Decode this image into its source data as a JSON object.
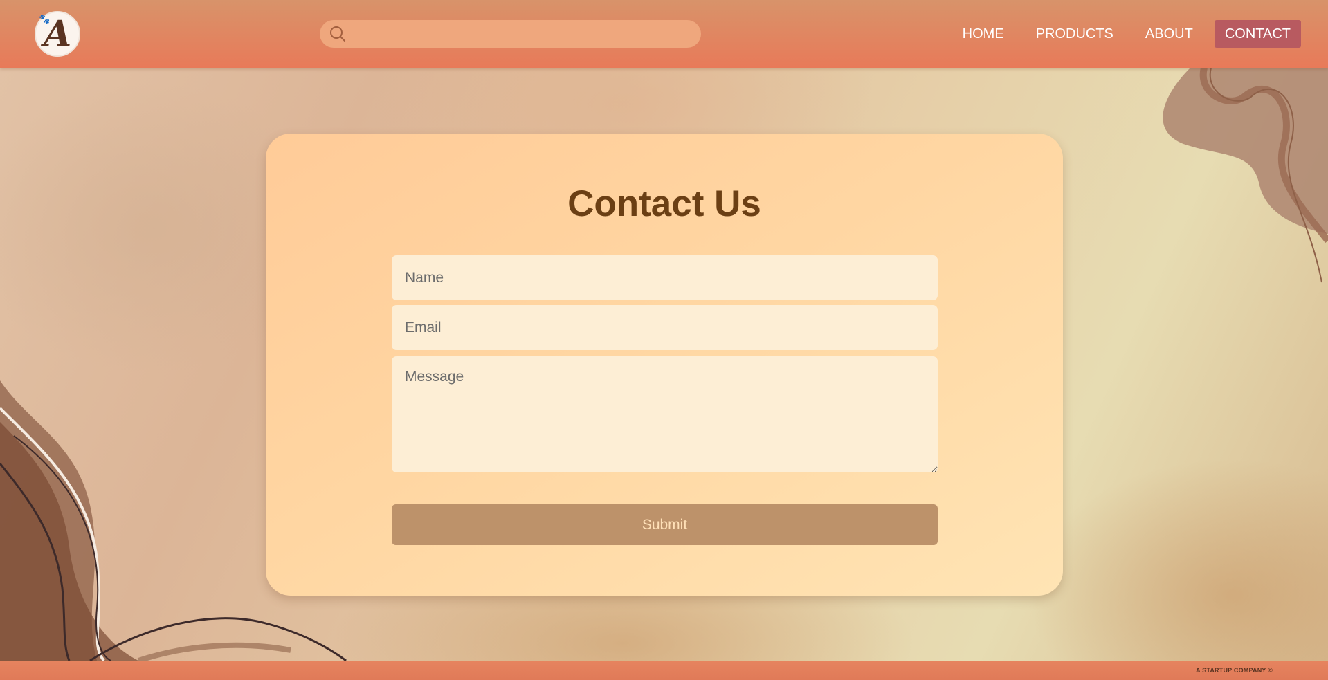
{
  "header": {
    "logo_letter": "A",
    "search": {
      "placeholder": "",
      "value": ""
    },
    "nav": [
      {
        "label": "HOME",
        "active": false
      },
      {
        "label": "PRODUCTS",
        "active": false
      },
      {
        "label": "ABOUT",
        "active": false
      },
      {
        "label": "CONTACT",
        "active": true
      }
    ]
  },
  "contact_form": {
    "title": "Contact Us",
    "name_placeholder": "Name",
    "email_placeholder": "Email",
    "message_placeholder": "Message",
    "submit_label": "Submit"
  },
  "footer": {
    "text": "A STARTUP COMPANY ©"
  },
  "colors": {
    "header": "#e87a59",
    "nav_active": "#b85a60",
    "card": "#ffd6a2",
    "title": "#6b3f14",
    "submit": "#bd926a",
    "submit_text": "#ffe0b7",
    "field": "#fdeed5"
  },
  "icons": {
    "search": "search-icon",
    "logo": "paw-logo-icon"
  }
}
